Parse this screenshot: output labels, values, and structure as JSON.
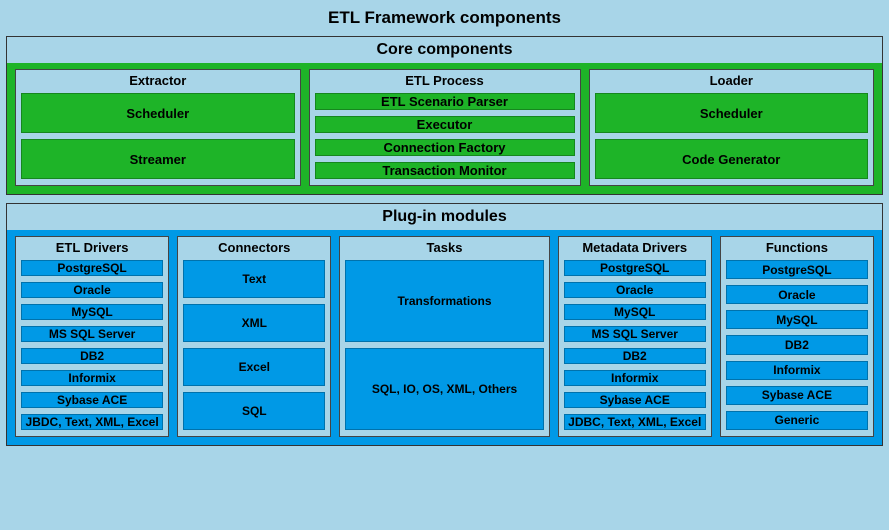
{
  "title": "ETL Framework components",
  "core": {
    "header": "Core components",
    "extractor": {
      "header": "Extractor",
      "items": [
        "Scheduler",
        "Streamer"
      ]
    },
    "etlProcess": {
      "header": "ETL Process",
      "items": [
        "ETL Scenario Parser",
        "Executor",
        "Connection Factory",
        "Transaction Monitor"
      ]
    },
    "loader": {
      "header": "Loader",
      "items": [
        "Scheduler",
        "Code Generator"
      ]
    }
  },
  "plugin": {
    "header": "Plug-in modules",
    "etlDrivers": {
      "header": "ETL Drivers",
      "items": [
        "PostgreSQL",
        "Oracle",
        "MySQL",
        "MS SQL Server",
        "DB2",
        "Informix",
        "Sybase ACE",
        "JBDC, Text, XML, Excel"
      ]
    },
    "connectors": {
      "header": "Connectors",
      "items": [
        "Text",
        "XML",
        "Excel",
        "SQL"
      ]
    },
    "tasks": {
      "header": "Tasks",
      "items": [
        "Transformations",
        "SQL, IO, OS, XML, Others"
      ]
    },
    "metadataDrivers": {
      "header": "Metadata Drivers",
      "items": [
        "PostgreSQL",
        "Oracle",
        "MySQL",
        "MS SQL Server",
        "DB2",
        "Informix",
        "Sybase ACE",
        "JDBC, Text, XML, Excel"
      ]
    },
    "functions": {
      "header": "Functions",
      "items": [
        "PostgreSQL",
        "Oracle",
        "MySQL",
        "DB2",
        "Informix",
        "Sybase ACE",
        "Generic"
      ]
    }
  }
}
